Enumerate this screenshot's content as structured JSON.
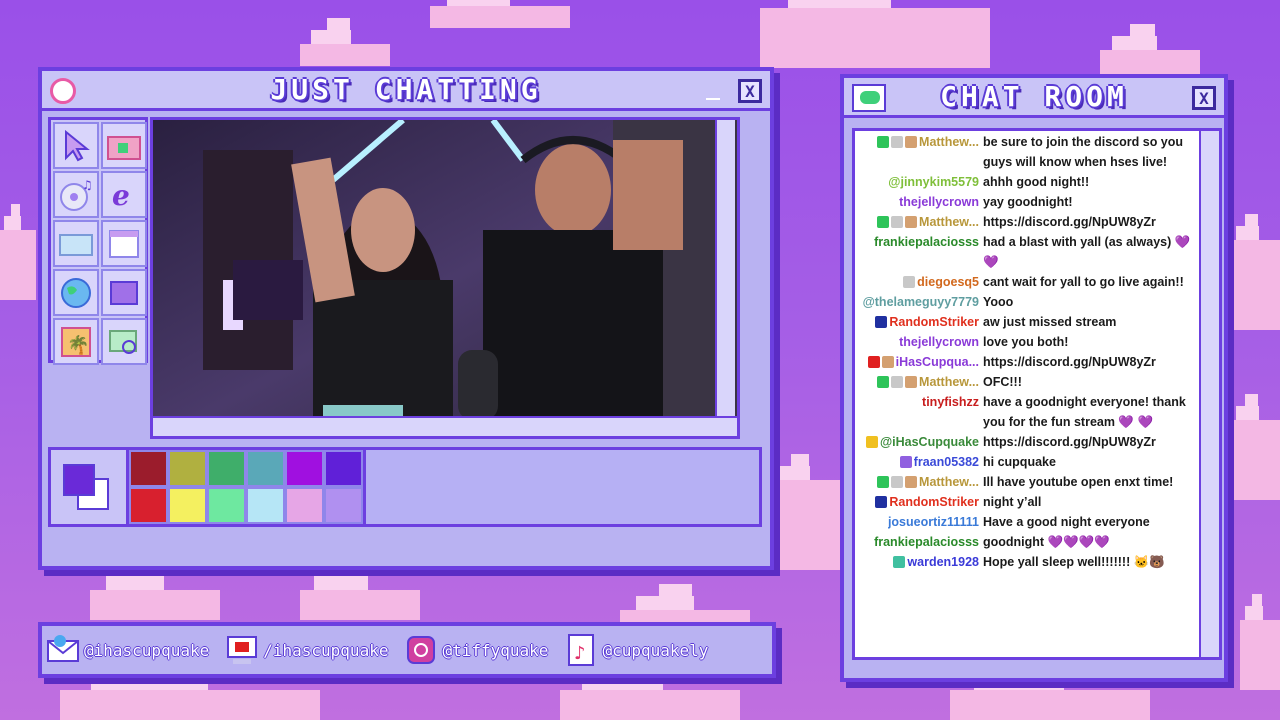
{
  "stream_window": {
    "title": "JUST CHATTING",
    "close": "X"
  },
  "chat_window": {
    "title": "CHAT ROOM",
    "close": "X"
  },
  "palette": {
    "colors": [
      "#9b1c2c",
      "#b0b040",
      "#3fae6a",
      "#5aa8b8",
      "#a010e0",
      "#6020d8",
      "#d8202e",
      "#f4f060",
      "#6ee8a0",
      "#b6e6f6",
      "#e6a6e6",
      "#b090f0"
    ],
    "primary": "#6a2ad8",
    "secondary": "#ffffff"
  },
  "tools": [
    "cursor-icon",
    "camera-folder-icon",
    "cd-icon",
    "browser-e-icon",
    "folder-icon",
    "calendar-icon",
    "globe-icon",
    "book-icon",
    "picture-icon",
    "map-icon"
  ],
  "chat": {
    "messages": [
      {
        "user": "Matthew...",
        "color": "#b8973a",
        "badges": [
          "#2ec45a",
          "#c8c8c8",
          "#d4a070"
        ],
        "text": "be sure to join the discord so you guys will know when hses live!"
      },
      {
        "user": "@jinnykim5579",
        "color": "#7fbf3a",
        "badges": [],
        "text": "ahhh good night!!"
      },
      {
        "user": "thejellycrown",
        "color": "#8a3ad8",
        "badges": [],
        "text": "yay goodnight!"
      },
      {
        "user": "Matthew...",
        "color": "#b8973a",
        "badges": [
          "#2ec45a",
          "#c8c8c8",
          "#d4a070"
        ],
        "text": "https://discord.gg/NpUW8yZr"
      },
      {
        "user": "frankiepalaciosss",
        "color": "#2a8a2a",
        "badges": [],
        "text": "had a blast with yall (as always) 💜💜"
      },
      {
        "user": "diegoesq5",
        "color": "#d2691e",
        "badges": [
          "#c8c8c8"
        ],
        "text": "cant wait for yall to go live again!!"
      },
      {
        "user": "@thelameguyy7779",
        "color": "#5f9ea0",
        "badges": [],
        "text": "Yooo"
      },
      {
        "user": "RandomStriker",
        "color": "#e0301e",
        "badges": [
          "#2030a0"
        ],
        "text": "aw just missed stream"
      },
      {
        "user": "thejellycrown",
        "color": "#8a3ad8",
        "badges": [],
        "text": "love you both!"
      },
      {
        "user": "iHasCupqua...",
        "color": "#8a3ad8",
        "badges": [
          "#e02020",
          "#d4a070"
        ],
        "text": "https://discord.gg/NpUW8yZr"
      },
      {
        "user": "Matthew...",
        "color": "#b8973a",
        "badges": [
          "#2ec45a",
          "#c8c8c8",
          "#d4a070"
        ],
        "text": "OFC!!!"
      },
      {
        "user": "tinyfishzz",
        "color": "#c81e1e",
        "badges": [],
        "text": "have a goodnight everyone! thank you for the fun stream 💜 💜"
      },
      {
        "user": "@iHasCupquake",
        "color": "#3a8a3a",
        "badges": [
          "#f0c020"
        ],
        "text": "https://discord.gg/NpUW8yZr"
      },
      {
        "user": "fraan05382",
        "color": "#3a4ad8",
        "badges": [
          "#9060e0"
        ],
        "text": "hi cupquake"
      },
      {
        "user": "Matthew...",
        "color": "#b8973a",
        "badges": [
          "#2ec45a",
          "#c8c8c8",
          "#d4a070"
        ],
        "text": "Ill have youtube open enxt time!"
      },
      {
        "user": "RandomStriker",
        "color": "#e0301e",
        "badges": [
          "#2030a0"
        ],
        "text": "night y’all"
      },
      {
        "user": "josueortiz11111",
        "color": "#3a7ad8",
        "badges": [],
        "text": "Have a good night everyone"
      },
      {
        "user": "frankiepalaciosss",
        "color": "#2a8a2a",
        "badges": [],
        "text": "goodnight 💜💜💜💜"
      },
      {
        "user": "warden1928",
        "color": "#3a3ad8",
        "badges": [
          "#40c0a0"
        ],
        "text": "Hope yall sleep well!!!!!!! 🐱🐻"
      }
    ]
  },
  "social": [
    {
      "icon": "twitter-mail-icon",
      "label": "@ihascupquake"
    },
    {
      "icon": "youtube-computer-icon",
      "label": "/ihascupquake"
    },
    {
      "icon": "instagram-icon",
      "label": "@tiffyquake"
    },
    {
      "icon": "tiktok-icon",
      "label": "@cupquakely"
    }
  ]
}
